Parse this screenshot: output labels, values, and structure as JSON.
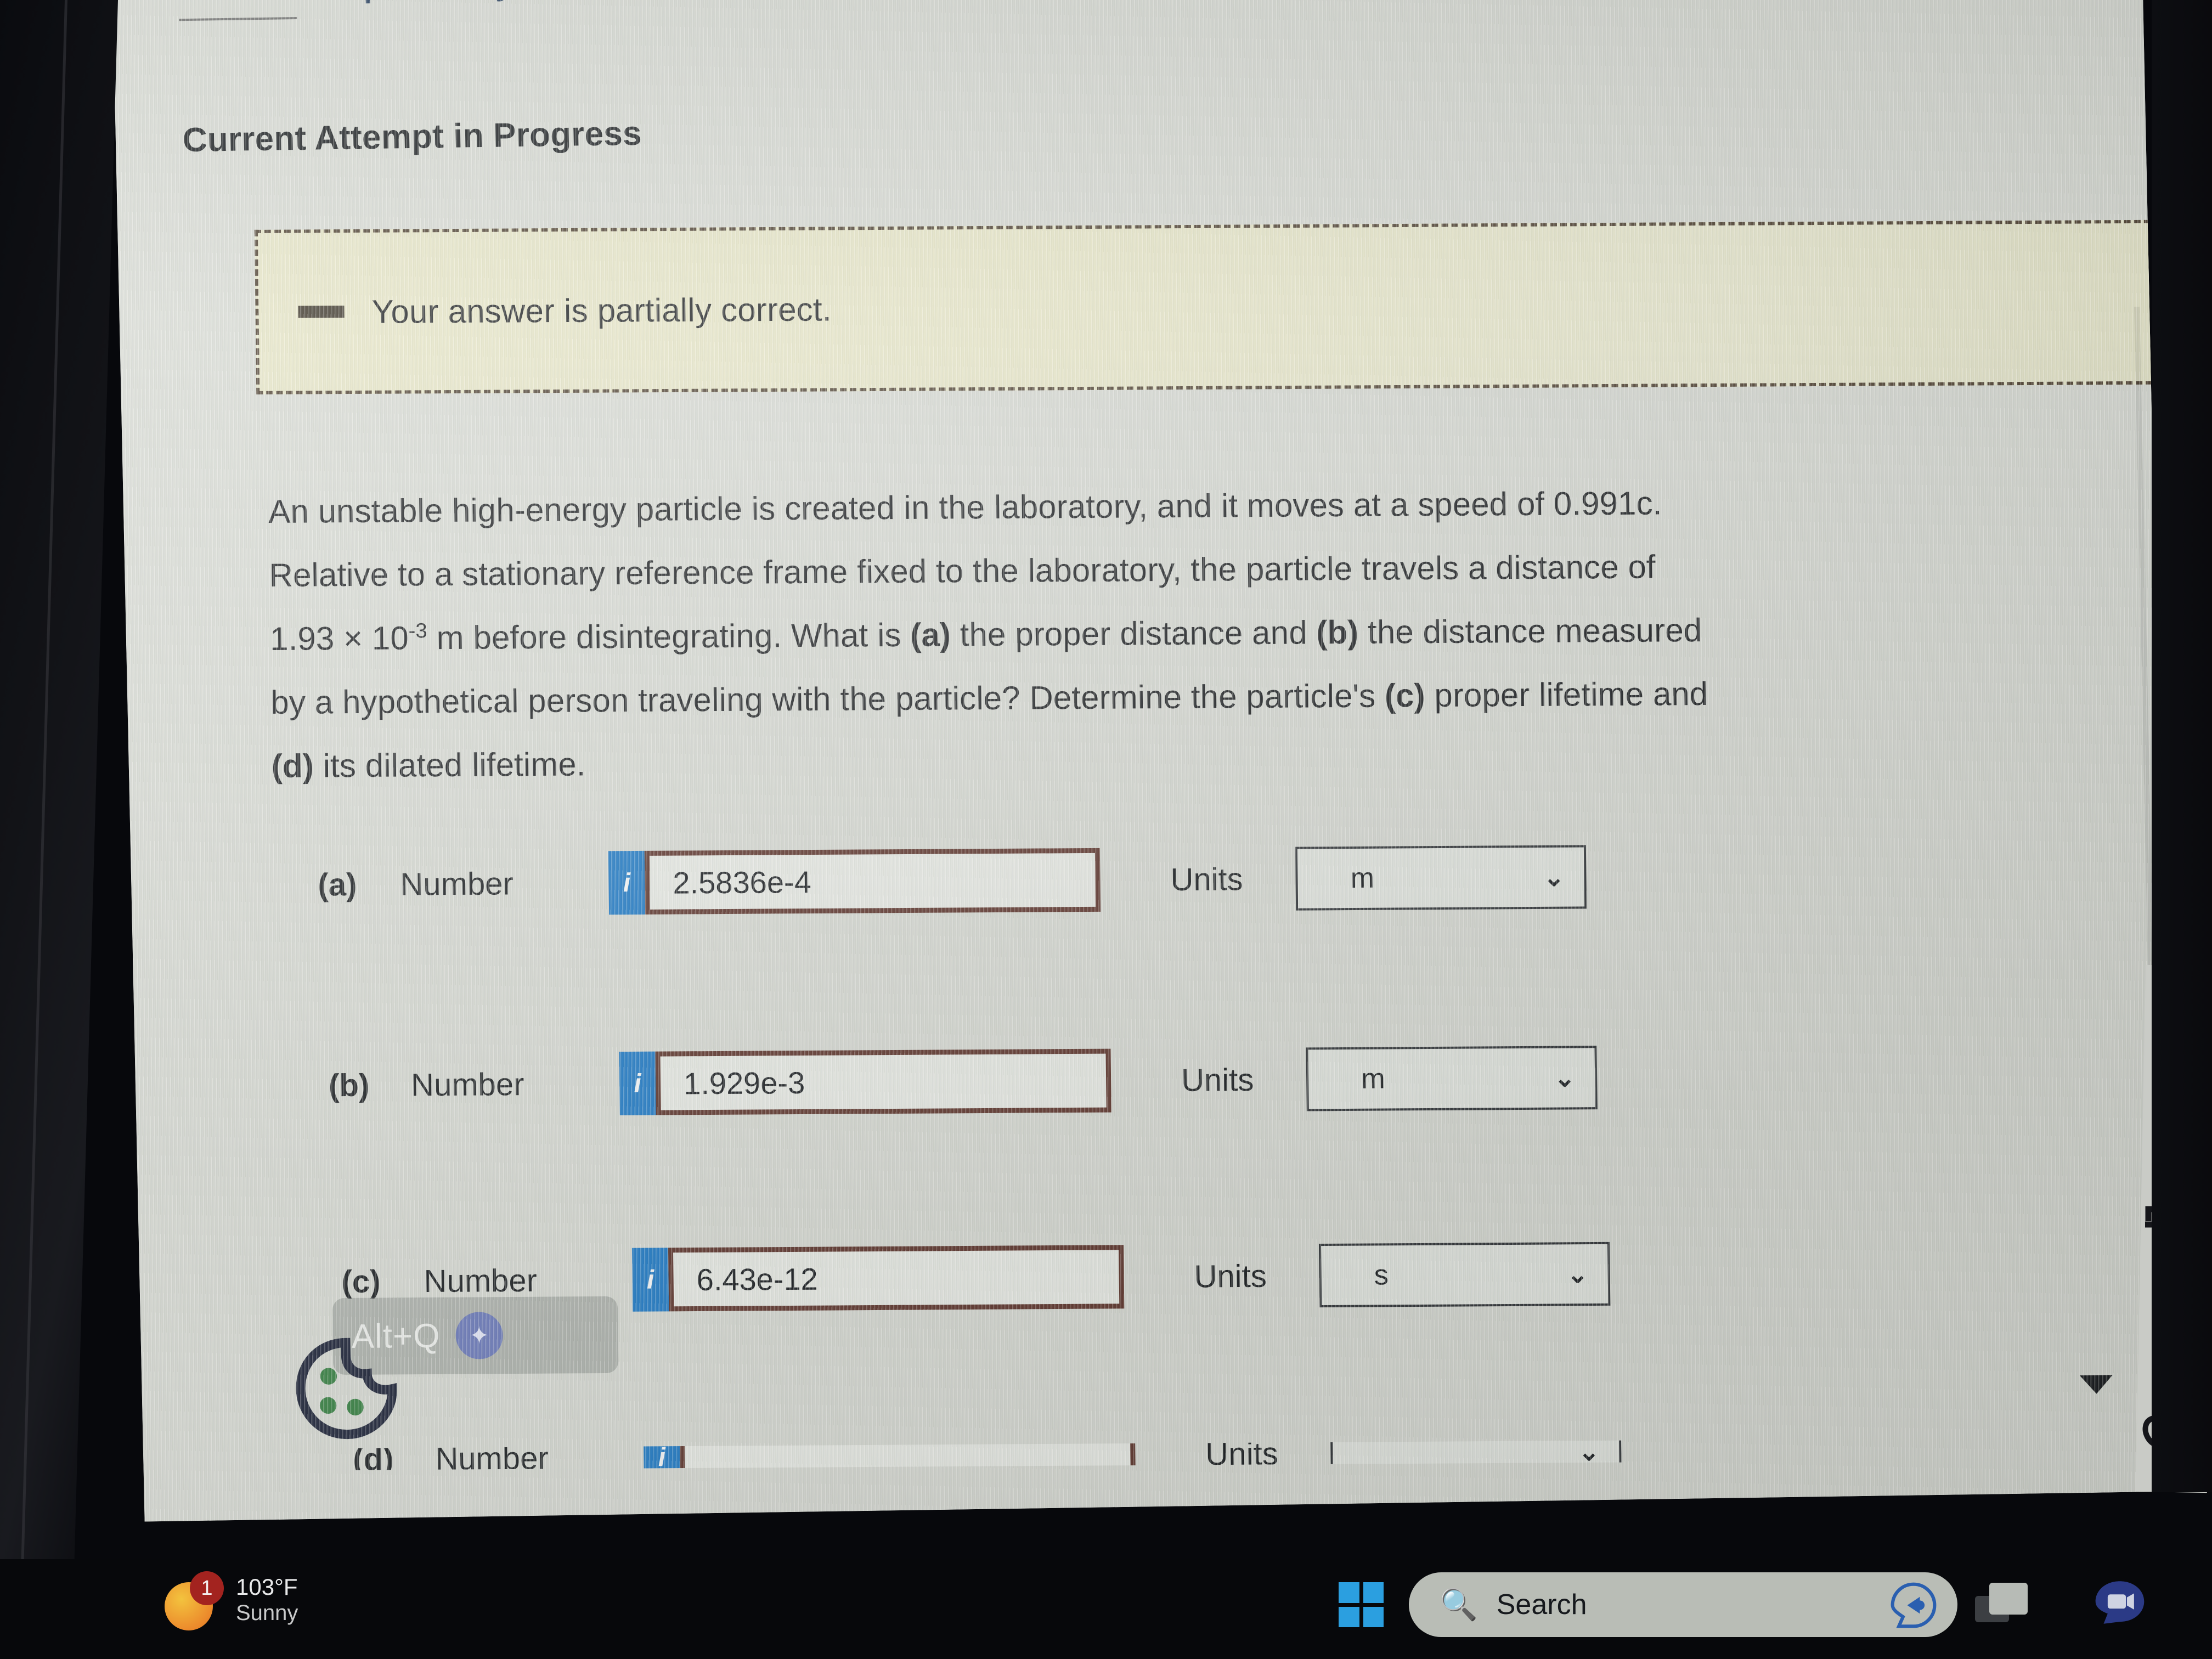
{
  "page": {
    "attempt_history_link": "Show Attempt History",
    "heading": "Current Attempt in Progress"
  },
  "banner": {
    "icon": "dash-icon",
    "text": "Your answer is partially correct."
  },
  "question": {
    "line1": "An unstable high-energy particle is created in the laboratory, and it moves at a speed of 0.991c.",
    "line2": "Relative to a stationary reference frame fixed to the laboratory, the particle travels a distance of",
    "line3_prefix": "1.93 × 10",
    "line3_exponent": "-3",
    "line3_mid": " m before disintegrating. What is ",
    "label_a": "(a)",
    "line3_after_a": " the proper distance and ",
    "label_b": "(b)",
    "line3_end": " the distance measured",
    "line4_prefix": "by a hypothetical person traveling with the particle? Determine the particle's ",
    "label_c": "(c)",
    "line4_mid": " proper lifetime and",
    "label_d": "(d)",
    "line5_end": " its dilated lifetime."
  },
  "answers": {
    "number_label": "Number",
    "units_label": "Units",
    "info_icon": "info-icon",
    "chevron": "⌄",
    "rows": [
      {
        "part": "(a)",
        "value": "2.5836e-4",
        "unit": "m",
        "state": "incorrect"
      },
      {
        "part": "(b)",
        "value": "1.929e-3",
        "unit": "m",
        "state": "incorrect"
      },
      {
        "part": "(c)",
        "value": "6.43e-12",
        "unit": "s",
        "state": "incorrect"
      },
      {
        "part": "(d)",
        "value": "",
        "unit": "",
        "state": "incorrect"
      }
    ]
  },
  "overlay": {
    "altq_label": "Alt+Q",
    "altq_badge_icon": "sparkle-icon",
    "cookie_icon": "cookie-icon",
    "cursor_icon": "arrow-cursor-icon",
    "scroll_down_icon": "scroll-down-arrow-icon"
  },
  "taskbar": {
    "weather": {
      "icon": "sun-icon",
      "badge_count": "1",
      "temperature": "103°F",
      "condition": "Sunny"
    },
    "start_icon": "windows-start-icon",
    "search": {
      "icon": "search-icon",
      "placeholder": "Search",
      "copilot_icon": "copilot-icon"
    },
    "taskview_icon": "task-view-icon",
    "zoom_icon": "zoom-app-icon"
  },
  "colors": {
    "banner_bg": "#ecead0",
    "banner_border": "#4a3b2b",
    "input_error_border": "#5b2f26",
    "info_blue": "#1978c8",
    "link_navy": "#1d3557",
    "page_bg": "#dadcd5",
    "taskbar_bg": "#07080b",
    "badge_red": "#a3231f",
    "win_blue": "#2b9fe0"
  }
}
